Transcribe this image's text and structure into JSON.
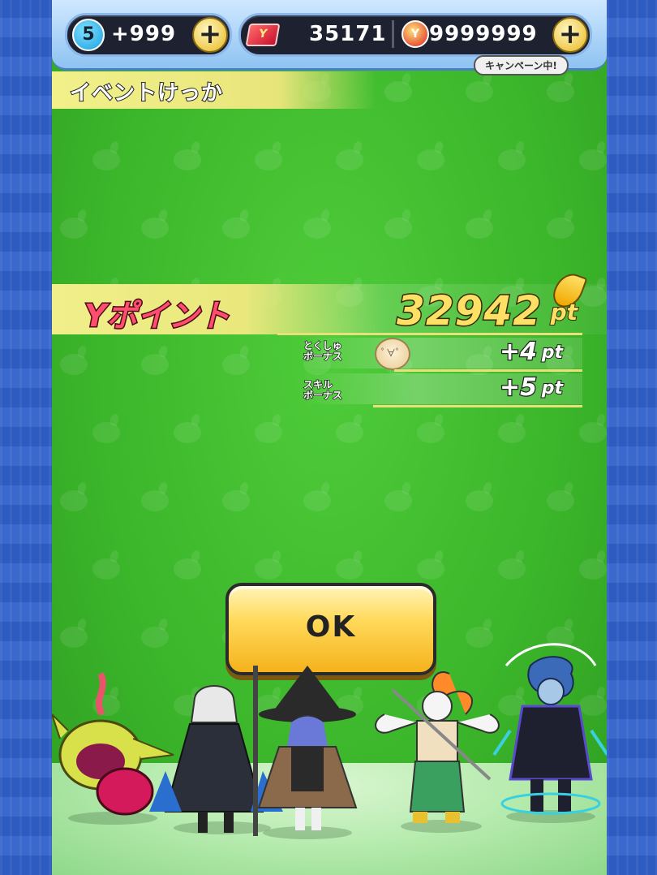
{
  "topbar": {
    "energy_count": "5",
    "energy_value": "+999",
    "currency1_value": "35171",
    "currency2_value": "9999999",
    "campaign_label": "キャンペーン中!",
    "card_icon_letter": "Y",
    "coin_icon_letter": "Y"
  },
  "header": {
    "title": "イベントけっか"
  },
  "result": {
    "points_label": "Yポイント",
    "points_value": "32942",
    "points_unit": "pt",
    "bonuses": [
      {
        "label_line1": "とくしゅ",
        "label_line2": "ボーナス",
        "value": "+4",
        "unit": "pt",
        "has_icon": true
      },
      {
        "label_line1": "スキル",
        "label_line2": "ボーナス",
        "value": "+5",
        "unit": "pt",
        "has_icon": false
      }
    ]
  },
  "ok_button": {
    "label": "OK"
  },
  "colors": {
    "background_green": "#3bb52a",
    "side_blue": "#2f5fc4",
    "button_yellow": "#ffd95a",
    "points_pink": "#ff4d6d",
    "points_gold": "#ffe066"
  }
}
